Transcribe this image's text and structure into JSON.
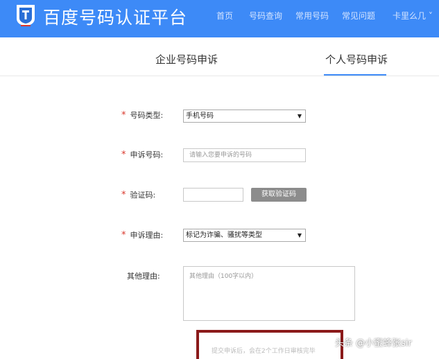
{
  "header": {
    "brand": "百度号码认证平台",
    "nav": [
      "首页",
      "号码查询",
      "常用号码",
      "常见问题",
      "卡里么几 ˅"
    ]
  },
  "tabs": [
    "企业号码申诉",
    "个人号码申诉"
  ],
  "form": {
    "required_mark": "*",
    "number_type": {
      "label": "号码类型:",
      "value": "手机号码",
      "arrow": "▼"
    },
    "appeal_number": {
      "label": "申诉号码:",
      "placeholder": "请输入您要申诉的号码"
    },
    "verify_code": {
      "label": "验证码:",
      "button": "获取验证码"
    },
    "reason": {
      "label": "申诉理由:",
      "value": "标记为诈骗、骚扰等类型",
      "arrow": "▼"
    },
    "other_reason": {
      "label": "其他理由:",
      "placeholder": "其他理由（100字以内）"
    }
  },
  "notice": "提交申诉后，会在2个工作日审核完毕",
  "watermark": "头条 @小蜜蜂张sir",
  "colors": {
    "header": "#3d8af7",
    "required": "#d9362b",
    "button": "#8c8c8c",
    "frame": "#8b1a1a"
  }
}
